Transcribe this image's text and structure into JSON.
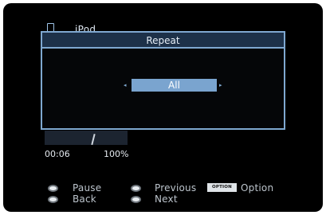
{
  "header": {
    "source_label": "iPod"
  },
  "popup": {
    "title": "Repeat",
    "value": "All",
    "arrow_left": "◂",
    "arrow_right": "▸"
  },
  "status": {
    "elapsed": "00:06",
    "volume": "100%"
  },
  "controls": {
    "pause_label": "Pause",
    "back_label": "Back",
    "previous_label": "Previous",
    "next_label": "Next",
    "option_badge": "OPTION",
    "option_label": "Option"
  },
  "colors": {
    "accent": "#7fa8d0",
    "selection": "#7aa4cf",
    "title_bar": "#1d3149",
    "background": "#000000"
  },
  "icons": {
    "source": "ipod-device-icon",
    "remote_buttons": "remote-button-icon"
  }
}
